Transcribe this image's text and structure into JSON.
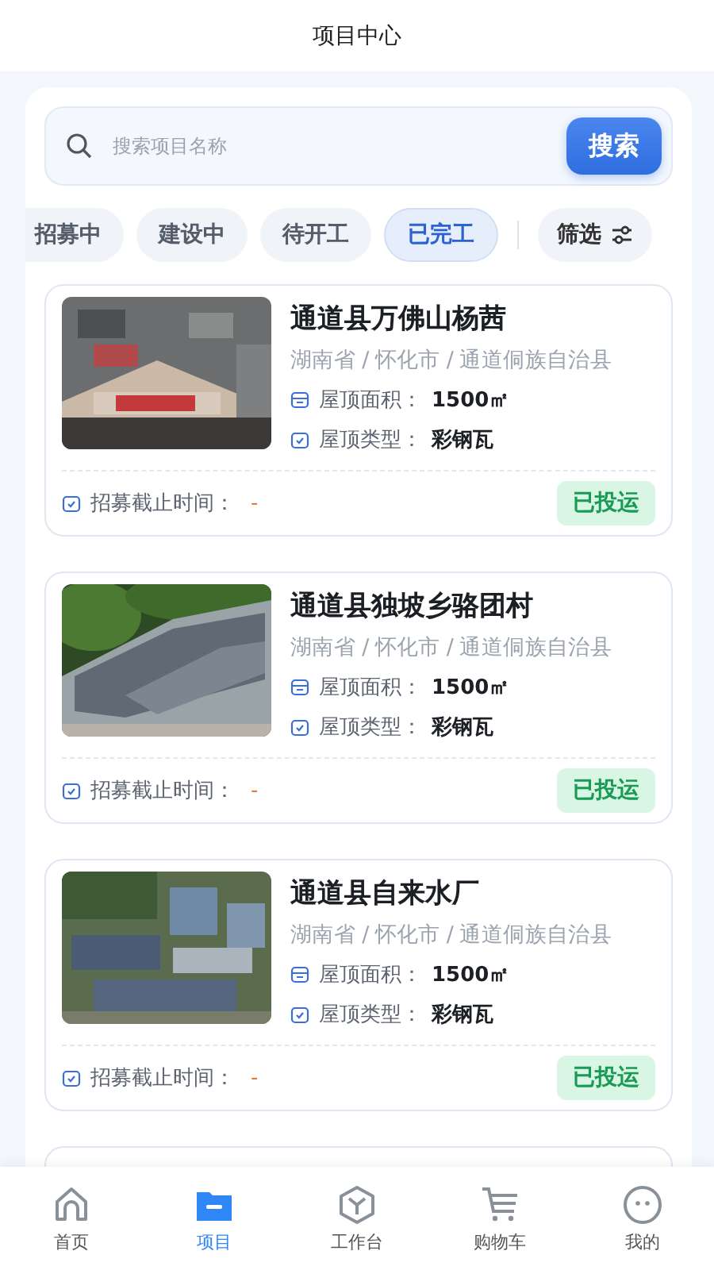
{
  "header": {
    "title": "项目中心"
  },
  "search": {
    "placeholder": "搜索项目名称",
    "button": "搜索"
  },
  "filters": [
    {
      "label": "招募中",
      "selected": false
    },
    {
      "label": "建设中",
      "selected": false
    },
    {
      "label": "待开工",
      "selected": false
    },
    {
      "label": "已完工",
      "selected": true
    }
  ],
  "filter_button": "筛选",
  "projects": [
    {
      "name": "通道县万佛山杨茜",
      "region": "湖南省 / 怀化市 / 通道侗族自治县",
      "area_label": "屋顶面积：",
      "area": "1500㎡",
      "type_label": "屋顶类型：",
      "roof_type": "彩钢瓦",
      "deadline_label": "招募截止时间：",
      "deadline": "-",
      "status": "已投运"
    },
    {
      "name": "通道县独坡乡骆团村",
      "region": "湖南省 / 怀化市 / 通道侗族自治县",
      "area_label": "屋顶面积：",
      "area": "1500㎡",
      "type_label": "屋顶类型：",
      "roof_type": "彩钢瓦",
      "deadline_label": "招募截止时间：",
      "deadline": "-",
      "status": "已投运"
    },
    {
      "name": "通道县自来水厂",
      "region": "湖南省 / 怀化市 / 通道侗族自治县",
      "area_label": "屋顶面积：",
      "area": "1500㎡",
      "type_label": "屋顶类型：",
      "roof_type": "彩钢瓦",
      "deadline_label": "招募截止时间：",
      "deadline": "-",
      "status": "已投运"
    }
  ],
  "tabbar": [
    {
      "label": "首页",
      "selected": false,
      "kind": "home"
    },
    {
      "label": "项目",
      "selected": true,
      "kind": "folder"
    },
    {
      "label": "工作台",
      "selected": false,
      "kind": "cube"
    },
    {
      "label": "购物车",
      "selected": false,
      "kind": "cart"
    },
    {
      "label": "我的",
      "selected": false,
      "kind": "face"
    }
  ]
}
